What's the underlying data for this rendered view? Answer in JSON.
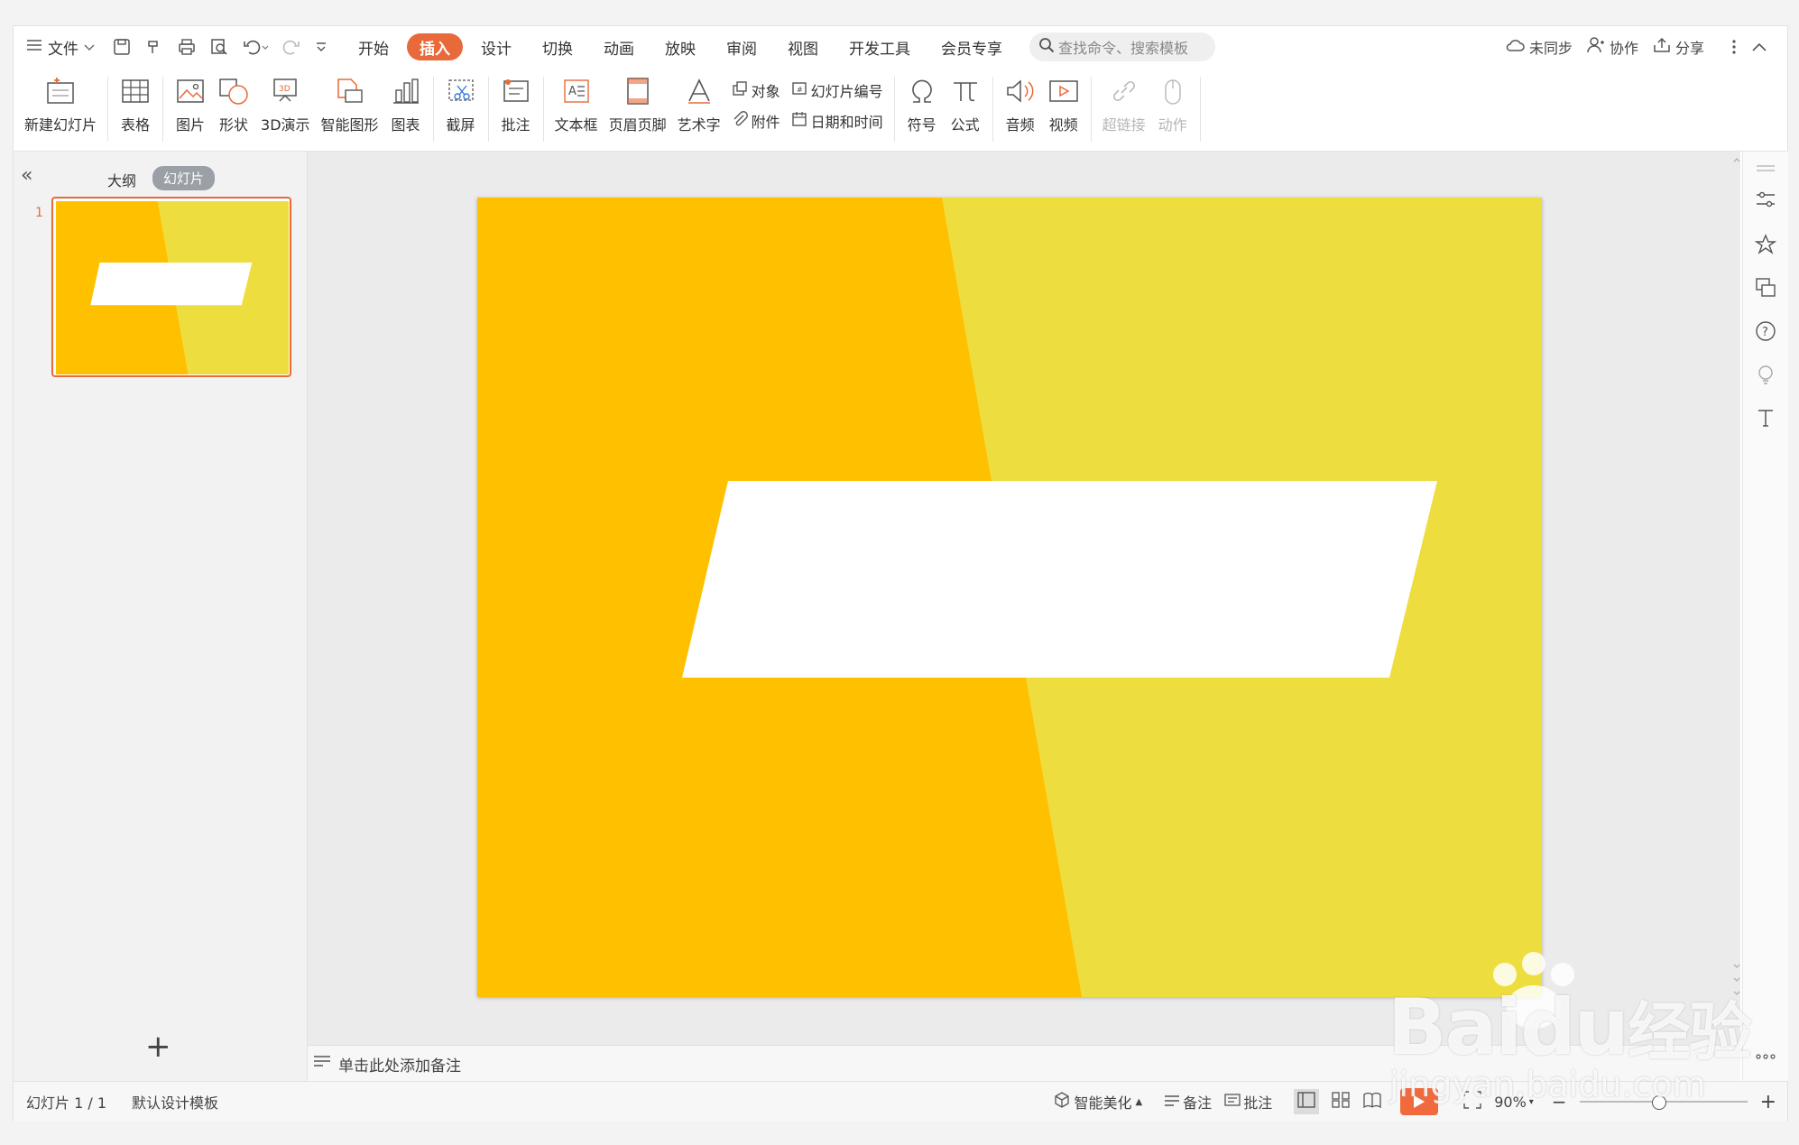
{
  "menu": {
    "file_label": "文件",
    "tabs": [
      "开始",
      "插入",
      "设计",
      "切换",
      "动画",
      "放映",
      "审阅",
      "视图",
      "开发工具",
      "会员专享"
    ],
    "active_tab": "插入",
    "search_placeholder": "查找命令、搜索模板",
    "sync_label": "未同步",
    "collab_label": "协作",
    "share_label": "分享"
  },
  "ribbon": {
    "new_slide": "新建幻灯片",
    "table": "表格",
    "picture": "图片",
    "shape": "形状",
    "demo3d": "3D演示",
    "smartart": "智能图形",
    "chart": "图表",
    "screenshot": "截屏",
    "comment": "批注",
    "textbox": "文本框",
    "header_footer": "页眉页脚",
    "wordart": "艺术字",
    "object": "对象",
    "slide_number": "幻灯片编号",
    "attachment": "附件",
    "datetime": "日期和时间",
    "symbol": "符号",
    "formula": "公式",
    "audio": "音频",
    "video": "视频",
    "hyperlink": "超链接",
    "action": "动作"
  },
  "left_panel": {
    "outline_tab": "大纲",
    "slides_tab": "幻灯片",
    "slide_numbers": [
      "1"
    ]
  },
  "notes_placeholder": "单击此处添加备注",
  "status": {
    "slide_counter": "幻灯片 1 / 1",
    "template": "默认设计模板",
    "beautify": "智能美化",
    "notes": "备注",
    "comment": "批注",
    "zoom": "90%"
  },
  "slide_colors": {
    "left": "#FFC000",
    "right": "#EEDD3E",
    "banner": "#FFFFFF"
  },
  "watermark": {
    "brand": "Bai",
    "brand_tail": "du",
    "cn": "经验",
    "url": "jingyan.baidu.com"
  }
}
